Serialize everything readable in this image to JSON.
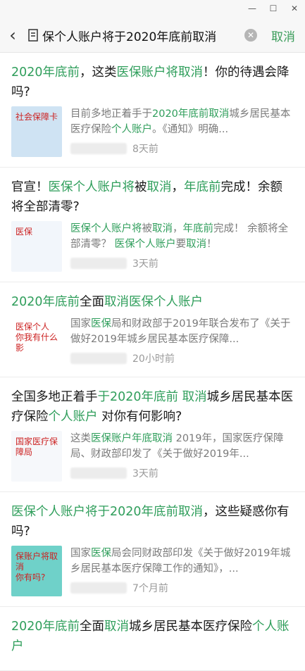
{
  "searchbar": {
    "query": "保个人账户将于2020年底前取消",
    "cancel_label": "取消"
  },
  "results": [
    {
      "title": [
        {
          "text": "2020年底前",
          "hl": true
        },
        {
          "text": "，这类",
          "hl": false
        },
        {
          "text": "医保账户将取消",
          "hl": true
        },
        {
          "text": "！你的待遇会降吗?",
          "hl": false
        }
      ],
      "snippet": [
        {
          "text": "目前多地正着手于",
          "hl": false
        },
        {
          "text": "2020年底前取消",
          "hl": true
        },
        {
          "text": "城乡居民基本医疗保险",
          "hl": false
        },
        {
          "text": "个人账户",
          "hl": true
        },
        {
          "text": "。《通知》明确...",
          "hl": false
        }
      ],
      "time": "8天前"
    },
    {
      "title": [
        {
          "text": "官宣！",
          "hl": false
        },
        {
          "text": "医保个人账户将",
          "hl": true
        },
        {
          "text": "被",
          "hl": false
        },
        {
          "text": "取消",
          "hl": true
        },
        {
          "text": "，",
          "hl": false
        },
        {
          "text": "年底前",
          "hl": true
        },
        {
          "text": "完成！余额将全部清零?",
          "hl": false
        }
      ],
      "snippet": [
        {
          "text": "医保个人账户将",
          "hl": true
        },
        {
          "text": "被",
          "hl": false
        },
        {
          "text": "取消",
          "hl": true
        },
        {
          "text": "，",
          "hl": false
        },
        {
          "text": "年底前",
          "hl": true
        },
        {
          "text": "完成！ 余额将全部清零？ ",
          "hl": false
        },
        {
          "text": "医保个人账户",
          "hl": true
        },
        {
          "text": "要",
          "hl": false
        },
        {
          "text": "取消",
          "hl": true
        },
        {
          "text": "！",
          "hl": false
        }
      ],
      "time": "3天前"
    },
    {
      "title": [
        {
          "text": "2020年底前",
          "hl": true
        },
        {
          "text": "全面",
          "hl": false
        },
        {
          "text": "取消医保个人账户",
          "hl": true
        }
      ],
      "snippet": [
        {
          "text": "国家",
          "hl": false
        },
        {
          "text": "医保",
          "hl": true
        },
        {
          "text": "局和财政部于2019年联合发布了《关于做好2019年城乡居民基本医疗保障...",
          "hl": false
        }
      ],
      "time": "20小时前"
    },
    {
      "title": [
        {
          "text": "全国多地正着手",
          "hl": false
        },
        {
          "text": "于2020年底前 取消",
          "hl": true
        },
        {
          "text": "城乡居民基本医疗保险",
          "hl": false
        },
        {
          "text": "个人账户",
          "hl": true
        },
        {
          "text": " 对你有何影响?",
          "hl": false
        }
      ],
      "snippet": [
        {
          "text": "这类",
          "hl": false
        },
        {
          "text": "医保账户年底取消",
          "hl": true
        },
        {
          "text": " 2019年，国家医疗保障局、财政部印发了《关于做好2019年...",
          "hl": false
        }
      ],
      "time": "3天前"
    },
    {
      "title": [
        {
          "text": "医保个人账户将于2020年底前取消",
          "hl": true
        },
        {
          "text": "，这些疑惑你有吗?",
          "hl": false
        }
      ],
      "snippet": [
        {
          "text": "国家",
          "hl": false
        },
        {
          "text": "医保",
          "hl": true
        },
        {
          "text": "局会同财政部印发《关于做好2019年城乡居民基本医疗保障工作的通知》，...",
          "hl": false
        }
      ],
      "time": "7个月前"
    },
    {
      "title": [
        {
          "text": "2020年底前",
          "hl": true
        },
        {
          "text": "全面",
          "hl": false
        },
        {
          "text": "取消",
          "hl": true
        },
        {
          "text": "城乡居民基本医疗保险",
          "hl": false
        },
        {
          "text": "个人账户",
          "hl": true
        }
      ],
      "snippet": [],
      "time": ""
    }
  ],
  "thumbs": [
    {
      "label": "社会保障卡",
      "bg": "#cfe3f3"
    },
    {
      "label": "医保",
      "bg": "#f2f6fb"
    },
    {
      "label": "医保个人\n你我有什么影",
      "bg": "#ffffff"
    },
    {
      "label": "国家医疗保障局",
      "bg": "#f6f8fb"
    },
    {
      "label": "保账户将取消\n你有吗?",
      "bg": "#6fd1c9"
    }
  ],
  "colors": {
    "highlight": "#2f9e5b",
    "cancel": "#3a9c5a"
  }
}
